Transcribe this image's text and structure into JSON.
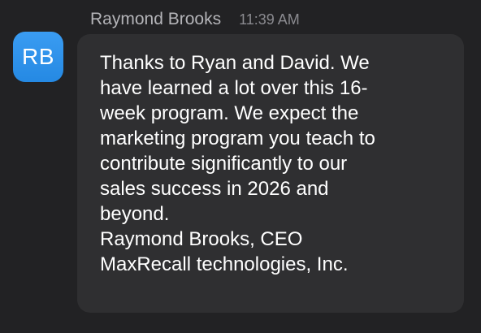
{
  "message": {
    "avatar_initials": "RB",
    "sender": "Raymond Brooks",
    "timestamp": "11:39 AM",
    "body_lines": [
      "Thanks to Ryan and David. We",
      "have learned a lot over this 16-",
      "week program. We expect the",
      "marketing program you teach to",
      "contribute significantly to our",
      "sales success in 2026 and",
      "beyond.",
      "Raymond Brooks, CEO",
      "MaxRecall technologies, Inc."
    ]
  },
  "colors": {
    "background": "#222224",
    "bubble": "#2f2f31",
    "avatar": "#2b8fe8",
    "text": "#ffffff",
    "sender": "#b4b4b8",
    "timestamp": "#8b8b90"
  }
}
